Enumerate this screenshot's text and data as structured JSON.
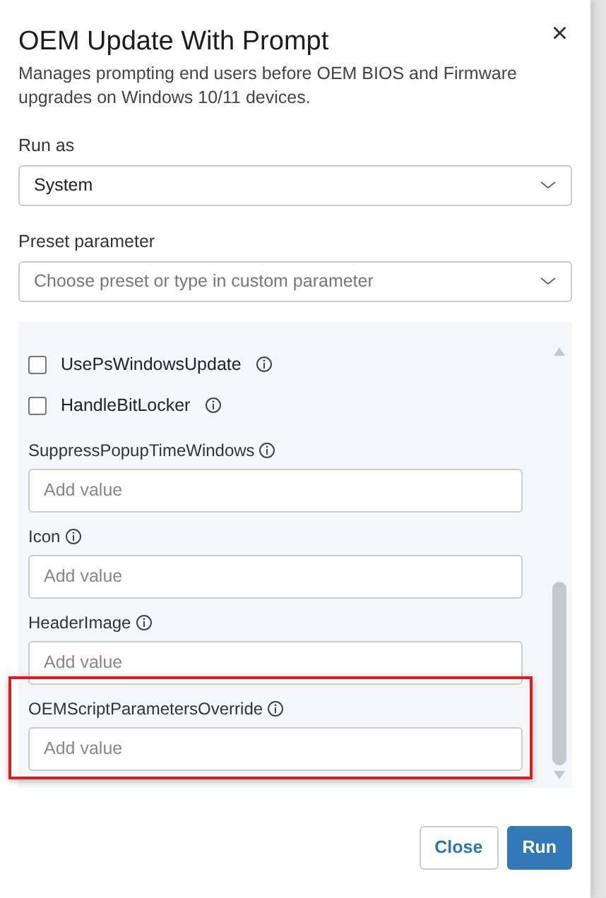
{
  "dialog": {
    "title": "OEM Update With Prompt",
    "description": "Manages prompting end users before OEM BIOS and Firmware upgrades on Windows 10/11 devices.",
    "close": "×"
  },
  "fields": [
    {
      "label": "Run as",
      "value": "System"
    },
    {
      "label": "Preset parameter",
      "placeholder": "Choose preset or type in custom parameter"
    }
  ],
  "parameters": [
    {
      "kind": "checkbox",
      "label": "UsePsWindowsUpdate",
      "checked": false,
      "highlighted": false
    },
    {
      "kind": "checkbox",
      "label": "HandleBitLocker",
      "checked": false,
      "highlighted": false
    },
    {
      "kind": "text",
      "label": "SuppressPopupTimeWindows",
      "placeholder": "Add value",
      "highlighted": false
    },
    {
      "kind": "text",
      "label": "Icon",
      "placeholder": "Add value",
      "highlighted": false
    },
    {
      "kind": "text",
      "label": "HeaderImage",
      "placeholder": "Add value",
      "highlighted": false
    },
    {
      "kind": "text",
      "label": "OEMScriptParametersOverride",
      "placeholder": "Add value",
      "highlighted": true
    }
  ],
  "buttons": [
    {
      "kind": "secondary",
      "label": "Close"
    },
    {
      "kind": "primary",
      "label": "Run"
    }
  ]
}
